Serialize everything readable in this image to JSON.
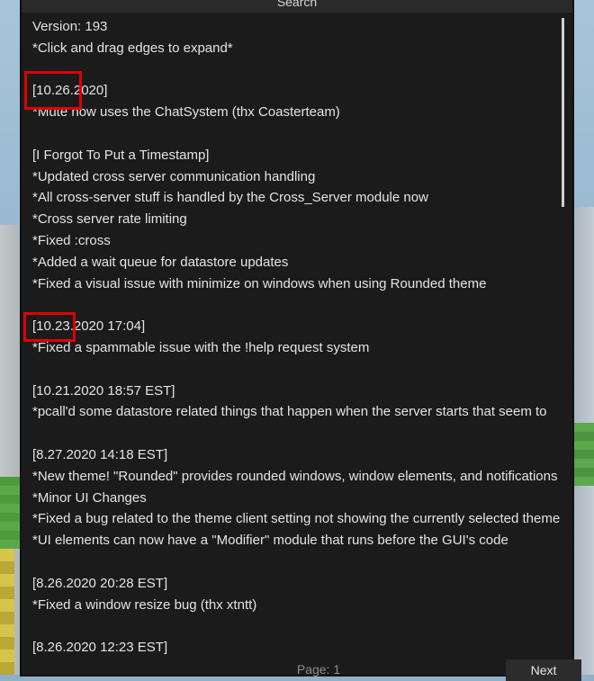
{
  "window": {
    "title": "Search"
  },
  "content_lines": [
    "Version: 193",
    "*Click and drag edges to expand*",
    "",
    "[10.26.2020]",
    "*Mute now uses the ChatSystem (thx Coasterteam)",
    "",
    "[I Forgot To Put a Timestamp]",
    "*Updated cross server communication handling",
    "*All cross-server stuff is handled by the Cross_Server module now",
    "*Cross server rate limiting",
    "*Fixed :cross",
    "*Added a wait queue for datastore updates",
    "*Fixed a visual issue with minimize on windows when using Rounded theme",
    "",
    "[10.23.2020 17:04]",
    "*Fixed a spammable issue with the !help request system",
    "",
    "[10.21.2020 18:57 EST]",
    "*pcall'd some datastore related things that happen when the server starts that seem to",
    "",
    "[8.27.2020 14:18 EST]",
    "*New theme! \"Rounded\"  provides rounded windows, window elements, and notifications",
    "*Minor UI Changes",
    "*Fixed a bug related to the theme client setting not showing the currently selected theme",
    "*UI elements can now have a \"Modifier\" module that runs before the GUI's code",
    "",
    "[8.26.2020 20:28 EST]",
    "*Fixed a window resize bug (thx xtntt)",
    "",
    "[8.26.2020 12:23 EST]"
  ],
  "footer": {
    "page_label": "Page: 1",
    "next_label": "Next"
  },
  "colors": {
    "window_bg": "#1b1b1c",
    "text": "#e4e4e4",
    "highlight": "#e00000"
  }
}
